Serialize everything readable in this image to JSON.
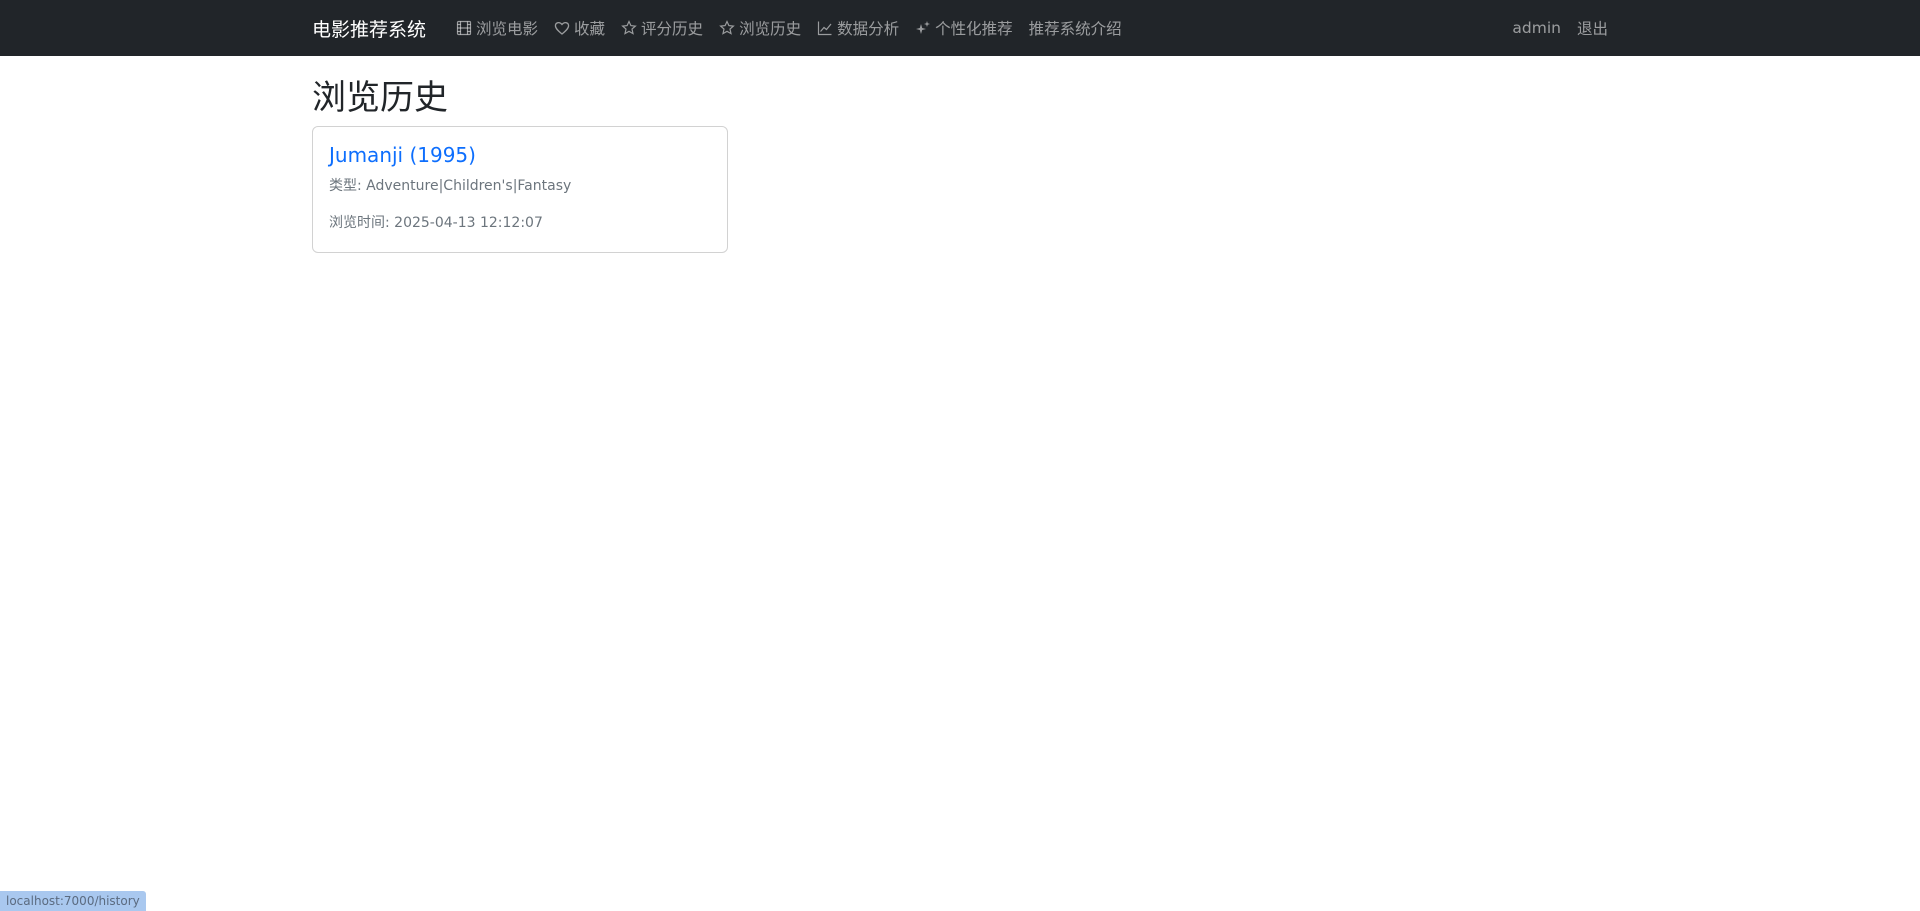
{
  "navbar": {
    "brand": "电影推荐系统",
    "links": [
      {
        "label": "浏览电影",
        "icon": "film-icon"
      },
      {
        "label": "收藏",
        "icon": "heart-icon"
      },
      {
        "label": "评分历史",
        "icon": "star-icon"
      },
      {
        "label": "浏览历史",
        "icon": "star-icon"
      },
      {
        "label": "数据分析",
        "icon": "chart-line-icon"
      },
      {
        "label": "个性化推荐",
        "icon": "sparkles-icon"
      },
      {
        "label": "推荐系统介绍"
      }
    ],
    "user": "admin",
    "logout": "退出"
  },
  "page": {
    "title": "浏览历史"
  },
  "history": [
    {
      "title": "Jumanji (1995)",
      "genres": "类型: Adventure|Children's|Fantasy",
      "viewed_at": "浏览时间: 2025-04-13 12:12:07"
    }
  ],
  "status_bar": {
    "url": "localhost:7000/history"
  },
  "colors": {
    "navbar_bg": "#212529",
    "link": "#0d6efd",
    "muted": "#6c757d"
  }
}
